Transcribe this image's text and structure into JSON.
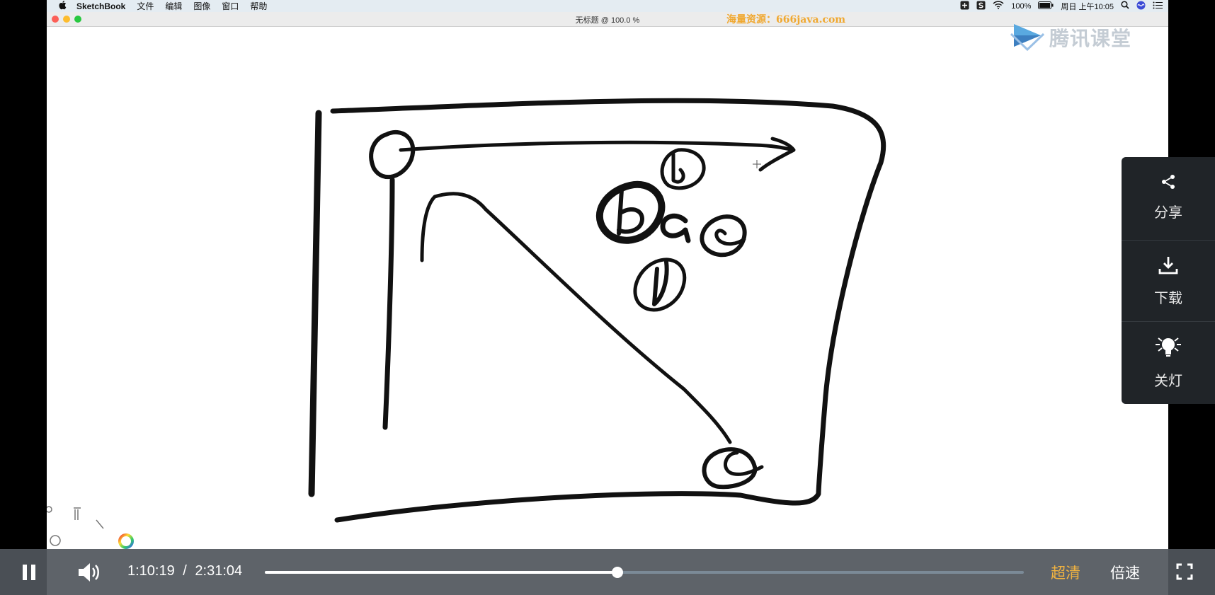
{
  "menubar": {
    "apple_icon": "apple-icon",
    "items": [
      "SketchBook",
      "文件",
      "编辑",
      "图像",
      "窗口",
      "帮助"
    ],
    "battery": "100%",
    "datetime": "周日 上午10:05"
  },
  "window": {
    "title": "无标题 @ 100.0 %",
    "traffic_colors": [
      "#fc5f57",
      "#fdbc2e",
      "#28c840"
    ]
  },
  "watermark": "海量资源：666java.com",
  "logo": {
    "text": "腾讯课堂",
    "icon": "tencent-classroom-logo-icon"
  },
  "side_panel": {
    "share_label": "分享",
    "download_label": "下载",
    "light_label": "关灯"
  },
  "player": {
    "current_time": "1:10:19",
    "separator": "/",
    "total_time": "2:31:04",
    "progress": 0.4647,
    "quality_label": "超清",
    "speed_label": "倍速"
  },
  "colors": {
    "accent_quality": "#f3b440",
    "control_bar": "#50565c",
    "side_panel": "#202428"
  }
}
